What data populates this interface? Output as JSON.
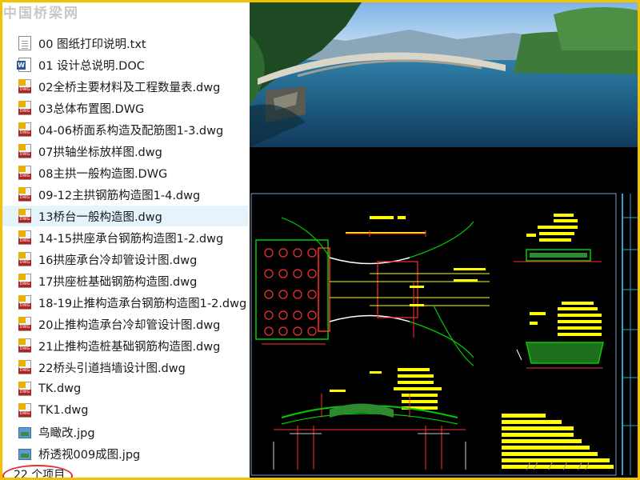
{
  "watermark": "中国桥梁网",
  "files": [
    {
      "name": "00 图纸打印说明.txt",
      "icon": "text-file-icon"
    },
    {
      "name": "01 设计总说明.DOC",
      "icon": "word-doc-icon"
    },
    {
      "name": "02全桥主要材料及工程数量表.dwg",
      "icon": "dwg-file-icon"
    },
    {
      "name": "03总体布置图.DWG",
      "icon": "dwg-file-icon"
    },
    {
      "name": "04-06桥面系构造及配筋图1-3.dwg",
      "icon": "dwg-file-icon"
    },
    {
      "name": "07拱轴坐标放样图.dwg",
      "icon": "dwg-file-icon"
    },
    {
      "name": "08主拱一般构造图.DWG",
      "icon": "dwg-file-icon"
    },
    {
      "name": "09-12主拱钢筋构造图1-4.dwg",
      "icon": "dwg-file-icon"
    },
    {
      "name": "13桥台一般构造图.dwg",
      "icon": "dwg-file-icon",
      "selected": true
    },
    {
      "name": "14-15拱座承台钢筋构造图1-2.dwg",
      "icon": "dwg-file-icon"
    },
    {
      "name": "16拱座承台冷却管设计图.dwg",
      "icon": "dwg-file-icon"
    },
    {
      "name": "17拱座桩基础钢筋构造图.dwg",
      "icon": "dwg-file-icon"
    },
    {
      "name": "18-19止推构造承台钢筋构造图1-2.dwg",
      "icon": "dwg-file-icon"
    },
    {
      "name": "20止推构造承台冷却管设计图.dwg",
      "icon": "dwg-file-icon"
    },
    {
      "name": "21止推构造桩基础钢筋构造图.dwg",
      "icon": "dwg-file-icon"
    },
    {
      "name": "22桥头引道挡墙设计图.dwg",
      "icon": "dwg-file-icon"
    },
    {
      "name": "TK.dwg",
      "icon": "dwg-file-icon"
    },
    {
      "name": "TK1.dwg",
      "icon": "dwg-file-icon"
    },
    {
      "name": "鸟瞰改.jpg",
      "icon": "image-file-icon"
    },
    {
      "name": "桥透视009成图.jpg",
      "icon": "image-file-icon"
    }
  ],
  "status": {
    "item_count": "22 个项目"
  },
  "colors": {
    "frame": "#f2c200",
    "cad_green": "#00cc00",
    "cad_yellow": "#ffff00",
    "cad_red": "#ff2020",
    "selection": "#e5f3fb",
    "highlight_ring": "#e03030"
  }
}
